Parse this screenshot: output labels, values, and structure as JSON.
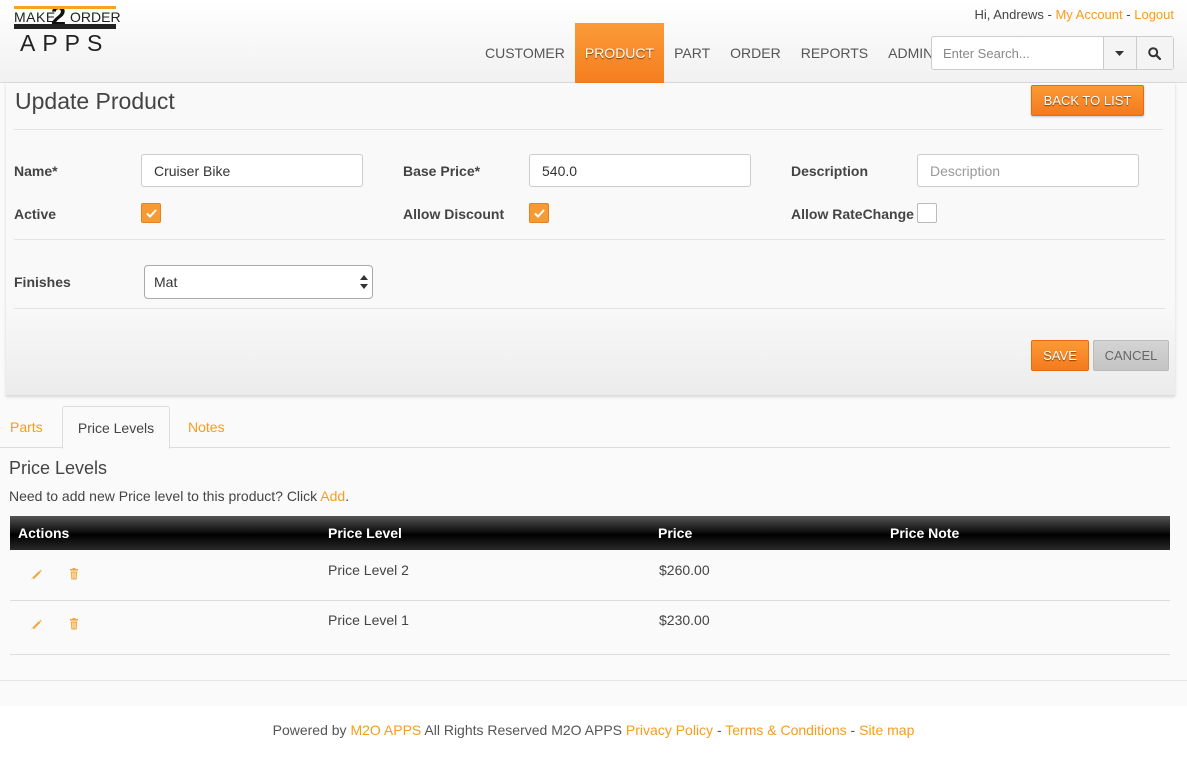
{
  "logo": {
    "make": "MAKE",
    "two": "2",
    "order": "ORDER",
    "apps": "APPS"
  },
  "user": {
    "greeting": "Hi, Andrews",
    "separator": "-",
    "my_account": "My Account",
    "logout": "Logout"
  },
  "nav": [
    "CUSTOMER",
    "PRODUCT",
    "PART",
    "ORDER",
    "REPORTS",
    "ADMIN"
  ],
  "nav_active": "PRODUCT",
  "search": {
    "placeholder": "Enter Search..."
  },
  "form": {
    "title": "Update Product",
    "back_label": "BACK TO LIST",
    "name_label": "Name*",
    "name_value": "Cruiser Bike",
    "base_price_label": "Base Price*",
    "base_price_value": "540.0",
    "description_label": "Description",
    "description_placeholder": "Description",
    "active_label": "Active",
    "active_checked": true,
    "allow_discount_label": "Allow Discount",
    "allow_discount_checked": true,
    "allow_ratechange_label": "Allow RateChange",
    "allow_ratechange_checked": false,
    "finishes_label": "Finishes",
    "finishes_value": "Mat",
    "save_label": "SAVE",
    "cancel_label": "CANCEL"
  },
  "tabs": [
    {
      "label": "Parts",
      "active": false
    },
    {
      "label": "Price Levels",
      "active": true
    },
    {
      "label": "Notes",
      "active": false
    }
  ],
  "price_levels": {
    "title": "Price Levels",
    "hint_prefix": "Need to add new Price level to this product? Click",
    "hint_link": "Add",
    "hint_suffix": ".",
    "columns": [
      "Actions",
      "Price Level",
      "Price",
      "Price Note"
    ],
    "rows": [
      {
        "level": "Price Level 2",
        "price": "$260.00",
        "note": ""
      },
      {
        "level": "Price Level 1",
        "price": "$230.00",
        "note": ""
      }
    ]
  },
  "footer": {
    "powered_by": "Powered by",
    "brand": "M2O APPS",
    "rights": "All Rights Reserved M2O APPS",
    "privacy": "Privacy Policy",
    "terms": "Terms & Conditions",
    "sitemap": "Site map",
    "sep": "-"
  },
  "colors": {
    "accent": "#f89c1c",
    "active_nav": "#f57d1f",
    "table_header": "#000000"
  }
}
